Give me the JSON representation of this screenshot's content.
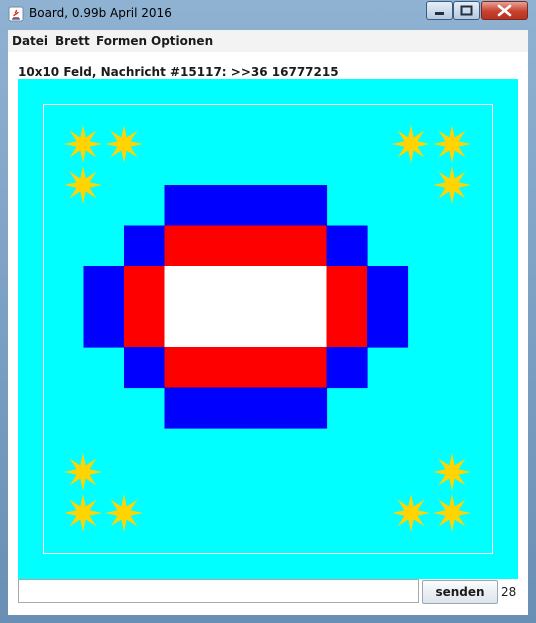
{
  "window": {
    "title": "Board, 0.99b April 2016",
    "frame_color": "#7fa3c6",
    "close_color": "#c7412d"
  },
  "menubar": {
    "items": [
      "Datei",
      "Brett",
      "Formen",
      "Optionen"
    ]
  },
  "status": {
    "text": "10x10 Feld, Nachricht #15117: >>36 16777215"
  },
  "board": {
    "size": 10,
    "background": "#00ffff",
    "border_color": "#ffffff",
    "colors": {
      "B": "#0000ff",
      "R": "#ff0000",
      "W": "#ffffff"
    },
    "cells": [
      "..........",
      "..........",
      "...BBBB...",
      "..BRRRRB..",
      ".BRWWWWRB.",
      ".BRWWWWRB.",
      "..BRRRRB..",
      "...BBBB...",
      "..........",
      ".........."
    ],
    "star_color": "#ffd400",
    "stars": [
      {
        "row": 0,
        "col": 0,
        "count": 3
      },
      {
        "row": 0,
        "col": 9,
        "count": 3
      },
      {
        "row": 9,
        "col": 0,
        "count": 3
      },
      {
        "row": 9,
        "col": 9,
        "count": 3
      }
    ]
  },
  "input": {
    "value": "",
    "placeholder": ""
  },
  "send_button": {
    "label": "senden"
  },
  "counter": {
    "value": "28"
  }
}
